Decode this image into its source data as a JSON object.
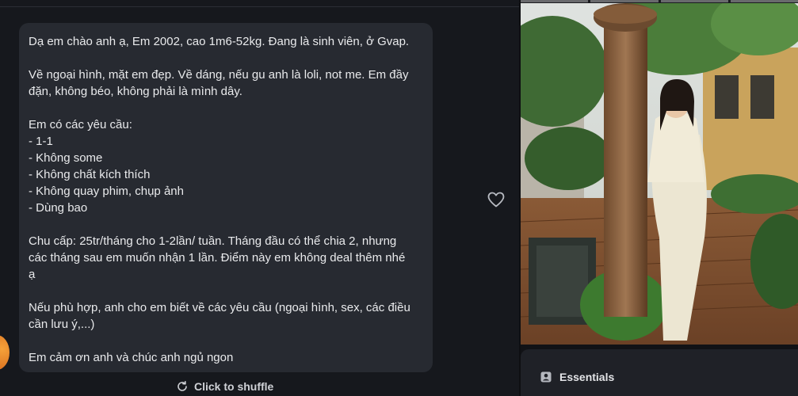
{
  "message": {
    "paragraphs": [
      [
        "Dạ em chào anh ạ, Em 2002, cao 1m6-52kg. Đang là sinh viên, ở Gvap."
      ],
      [
        "Về ngoại hình, mặt em đẹp. Về dáng, nếu gu anh là loli, not me. Em đầy",
        "đặn, không béo, không phải là mình dây."
      ],
      [
        "Em có các yêu cầu:",
        "- 1-1",
        "- Không some",
        "- Không chất kích thích",
        "- Không quay phim, chụp ảnh",
        "- Dùng bao"
      ],
      [
        "Chu cấp: 25tr/tháng cho 1-2lần/ tuần. Tháng đầu có thể chia 2, nhưng",
        "các tháng sau em muốn nhận 1 lần. Điểm này em không deal thêm nhé",
        "ạ"
      ],
      [
        "Nếu phù hợp, anh cho em biết về các yêu cầu (ngoại hình, sex, các điều",
        "cần lưu ý,...)"
      ],
      [
        "Em cảm ơn anh và chúc anh ngủ ngon"
      ]
    ]
  },
  "actions": {
    "shuffle_label": "Click to shuffle",
    "like_icon": "heart-icon",
    "shuffle_icon": "refresh-icon"
  },
  "profile_panel": {
    "essentials_label": "Essentials",
    "essentials_icon": "profile-card-icon"
  },
  "colors": {
    "background": "#16181d",
    "bubble": "#272a31",
    "text": "#e9eaec"
  }
}
